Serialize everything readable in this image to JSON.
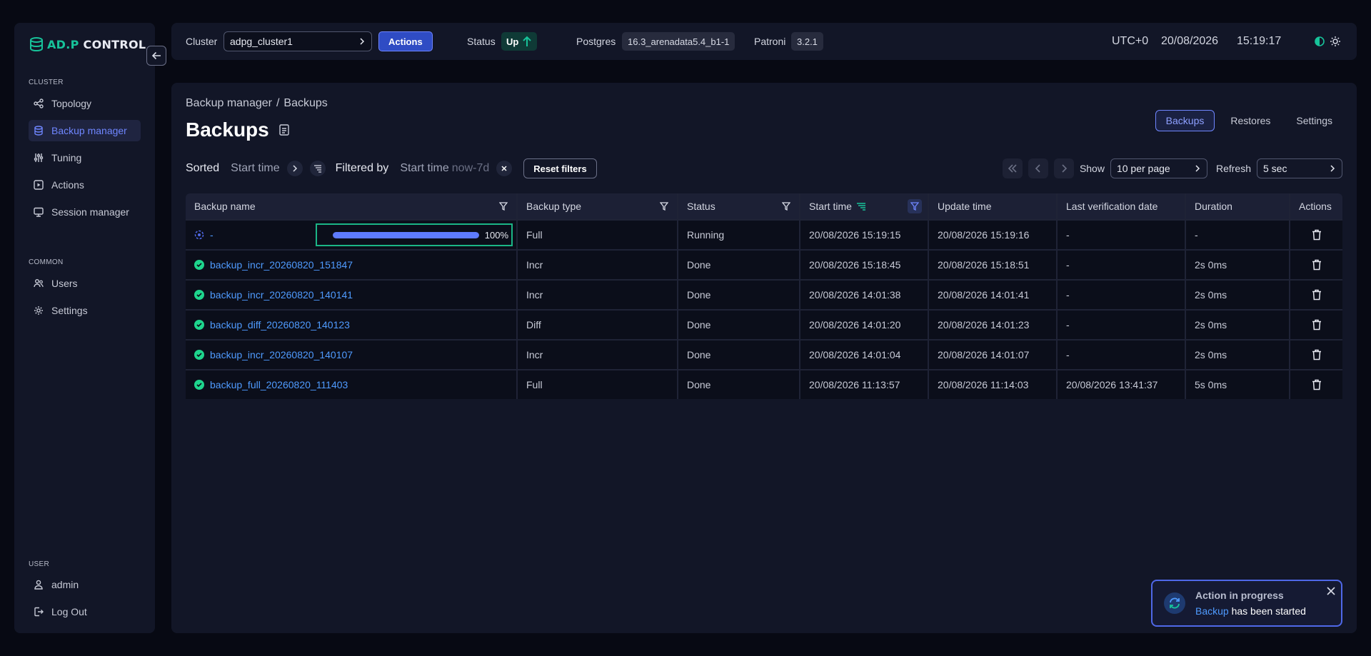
{
  "brand": {
    "logo_prefix": "AD.P",
    "logo_suffix": "CONTROL",
    "accent_color": "#17c39a"
  },
  "sidebar": {
    "sections": [
      {
        "label": "CLUSTER",
        "items": [
          {
            "label": "Topology",
            "icon": "topology-icon"
          },
          {
            "label": "Backup manager",
            "icon": "database-icon",
            "active": true
          },
          {
            "label": "Tuning",
            "icon": "sliders-icon"
          },
          {
            "label": "Actions",
            "icon": "play-icon"
          },
          {
            "label": "Session manager",
            "icon": "monitor-icon"
          }
        ]
      },
      {
        "label": "COMMON",
        "items": [
          {
            "label": "Users",
            "icon": "users-icon"
          },
          {
            "label": "Settings",
            "icon": "gear-icon"
          }
        ]
      },
      {
        "label": "USER",
        "items": [
          {
            "label": "admin",
            "icon": "user-icon"
          },
          {
            "label": "Log Out",
            "icon": "logout-icon"
          }
        ]
      }
    ]
  },
  "topbar": {
    "cluster_label": "Cluster",
    "cluster_value": "adpg_cluster1",
    "actions_label": "Actions",
    "status_label": "Status",
    "status_value": "Up",
    "postgres_label": "Postgres",
    "postgres_version": "16.3_arenadata5.4_b1-1",
    "patroni_label": "Patroni",
    "patroni_version": "3.2.1",
    "timezone": "UTC+0",
    "date": "20/08/2026",
    "time": "15:19:17"
  },
  "main": {
    "breadcrumb": [
      "Backup manager",
      "/",
      "Backups"
    ],
    "title": "Backups",
    "tabs": [
      "Backups",
      "Restores",
      "Settings"
    ],
    "active_tab": "Backups",
    "sorted_label": "Sorted",
    "sorted_value": "Start time",
    "filtered_label": "Filtered by",
    "filter_field": "Start time",
    "filter_value": "now-7d",
    "reset_label": "Reset filters",
    "show_label": "Show",
    "show_value": "10 per page",
    "refresh_label": "Refresh",
    "refresh_value": "5 sec"
  },
  "table": {
    "columns": [
      "Backup name",
      "Backup type",
      "Status",
      "Start time",
      "Update time",
      "Last verification date",
      "Duration",
      "Actions"
    ],
    "rows": [
      {
        "name": "-",
        "type": "Full",
        "status": "Running",
        "start": "20/08/2026 15:19:15",
        "update": "20/08/2026 15:19:16",
        "verified": "-",
        "duration": "-",
        "progress": 100,
        "progress_label": "100%",
        "running": true
      },
      {
        "name": "backup_incr_20260820_151847",
        "type": "Incr",
        "status": "Done",
        "start": "20/08/2026 15:18:45",
        "update": "20/08/2026 15:18:51",
        "verified": "-",
        "duration": "2s 0ms"
      },
      {
        "name": "backup_incr_20260820_140141",
        "type": "Incr",
        "status": "Done",
        "start": "20/08/2026 14:01:38",
        "update": "20/08/2026 14:01:41",
        "verified": "-",
        "duration": "2s 0ms"
      },
      {
        "name": "backup_diff_20260820_140123",
        "type": "Diff",
        "status": "Done",
        "start": "20/08/2026 14:01:20",
        "update": "20/08/2026 14:01:23",
        "verified": "-",
        "duration": "2s 0ms"
      },
      {
        "name": "backup_incr_20260820_140107",
        "type": "Incr",
        "status": "Done",
        "start": "20/08/2026 14:01:04",
        "update": "20/08/2026 14:01:07",
        "verified": "-",
        "duration": "2s 0ms"
      },
      {
        "name": "backup_full_20260820_111403",
        "type": "Full",
        "status": "Done",
        "start": "20/08/2026 11:13:57",
        "update": "20/08/2026 11:14:03",
        "verified": "20/08/2026 13:41:37",
        "duration": "5s 0ms"
      }
    ]
  },
  "toast": {
    "title": "Action in progress",
    "link": "Backup",
    "message": "has been started"
  }
}
